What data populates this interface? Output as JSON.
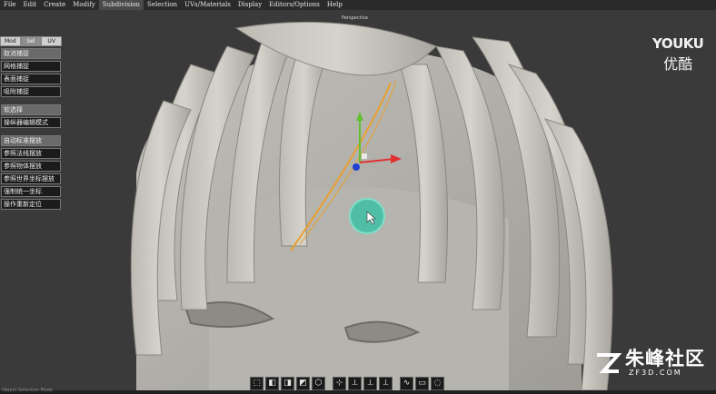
{
  "menubar": {
    "items": [
      "File",
      "Edit",
      "Create",
      "Modify",
      "Subdivision",
      "Selection",
      "UVs/Materials",
      "Display",
      "Editors/Options",
      "Help"
    ],
    "active_index": 4
  },
  "viewport": {
    "label": "Perspective"
  },
  "panel": {
    "tabs": [
      "Mod",
      "Sel",
      "UV"
    ],
    "active_tab": 1,
    "group1": [
      "取消捕捉",
      "网格捕捉",
      "表面捕捉",
      "吸附捕捉"
    ],
    "group2": [
      "软选择",
      "操纵器编辑模式"
    ],
    "group3": [
      "自动标准摆放",
      "参照法线摆放",
      "参照物体摆放",
      "参照世界坐标摆放",
      "强制统一坐标",
      "操作重新定位"
    ]
  },
  "toolbar": {
    "icons": [
      "perspective-cube-icon",
      "front-cube-icon",
      "side-cube-icon",
      "top-cube-icon",
      "shaded-hexagon-icon",
      "axis-xyz-icon",
      "axis-xy-icon",
      "axis-yz-icon",
      "axis-xz-icon",
      "curve-select-icon",
      "box-select-icon",
      "lasso-select-icon"
    ]
  },
  "status": {
    "text": "Object Selection Mode"
  },
  "watermarks": {
    "youku_en": "YOUKU",
    "youku_cn": "优酷",
    "zf_cn": "朱峰社区",
    "zf_en": "ZF3D.COM"
  },
  "colors": {
    "accent_teal": "#3ec0a4",
    "gizmo_x": "#e03030",
    "gizmo_y": "#60c030",
    "gizmo_z": "#2040d0",
    "selection_orange": "#e8a030"
  }
}
